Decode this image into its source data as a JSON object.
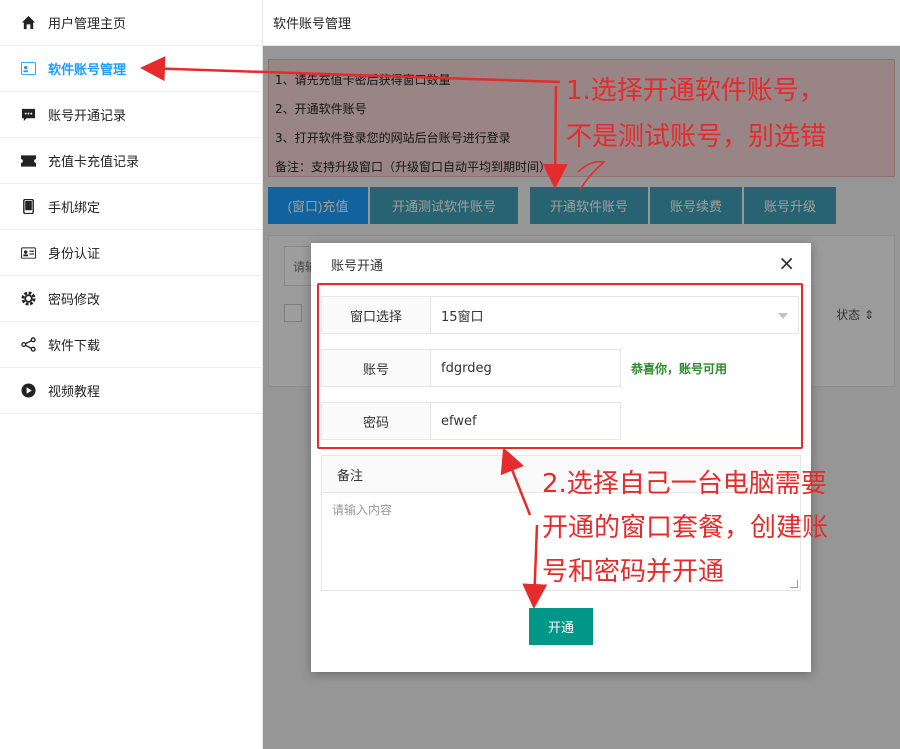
{
  "sidebar": {
    "items": [
      {
        "label": "用户管理主页",
        "icon": "home-icon"
      },
      {
        "label": "软件账号管理",
        "icon": "account-card-icon",
        "active": true
      },
      {
        "label": "账号开通记录",
        "icon": "chat-icon"
      },
      {
        "label": "充值卡充值记录",
        "icon": "ticket-icon"
      },
      {
        "label": "手机绑定",
        "icon": "phone-icon"
      },
      {
        "label": "身份认证",
        "icon": "id-card-icon"
      },
      {
        "label": "密码修改",
        "icon": "gear-icon"
      },
      {
        "label": "软件下载",
        "icon": "share-icon"
      },
      {
        "label": "视频教程",
        "icon": "play-icon"
      }
    ]
  },
  "header": {
    "title": "软件账号管理"
  },
  "notice": {
    "lines": [
      "1、请先充值卡密后获得窗口数量",
      "2、开通软件账号",
      "3、打开软件登录您的网站后台账号进行登录",
      "备注：支持升级窗口（升级窗口自动平均到期时间）"
    ]
  },
  "toolbar": {
    "buttons": [
      "(窗口)充值",
      "开通测试软件账号",
      "开通软件账号",
      "账号续费",
      "账号升级"
    ]
  },
  "table": {
    "search_placeholder": "请输",
    "state_column": "状态"
  },
  "modal": {
    "title": "账号开通",
    "close": "×",
    "window_label": "窗口选择",
    "window_value": "15窗口",
    "account_label": "账号",
    "account_value": "fdgrdeg",
    "account_ok": "恭喜你，账号可用",
    "password_label": "密码",
    "password_value": "efwef",
    "remark_label": "备注",
    "remark_placeholder": "请输入内容",
    "submit": "开通"
  },
  "annotations": {
    "note1": [
      "1.选择开通软件账号，",
      "不是测试账号，别选错"
    ],
    "note2": [
      "2.选择自己一台电脑需要",
      "开通的窗口套餐，创建账",
      "号和密码并开通"
    ]
  },
  "colors": {
    "accent": "#1e9fff",
    "teal": "#41a0b8",
    "success": "#009688",
    "annotation": "#e52b2b"
  }
}
